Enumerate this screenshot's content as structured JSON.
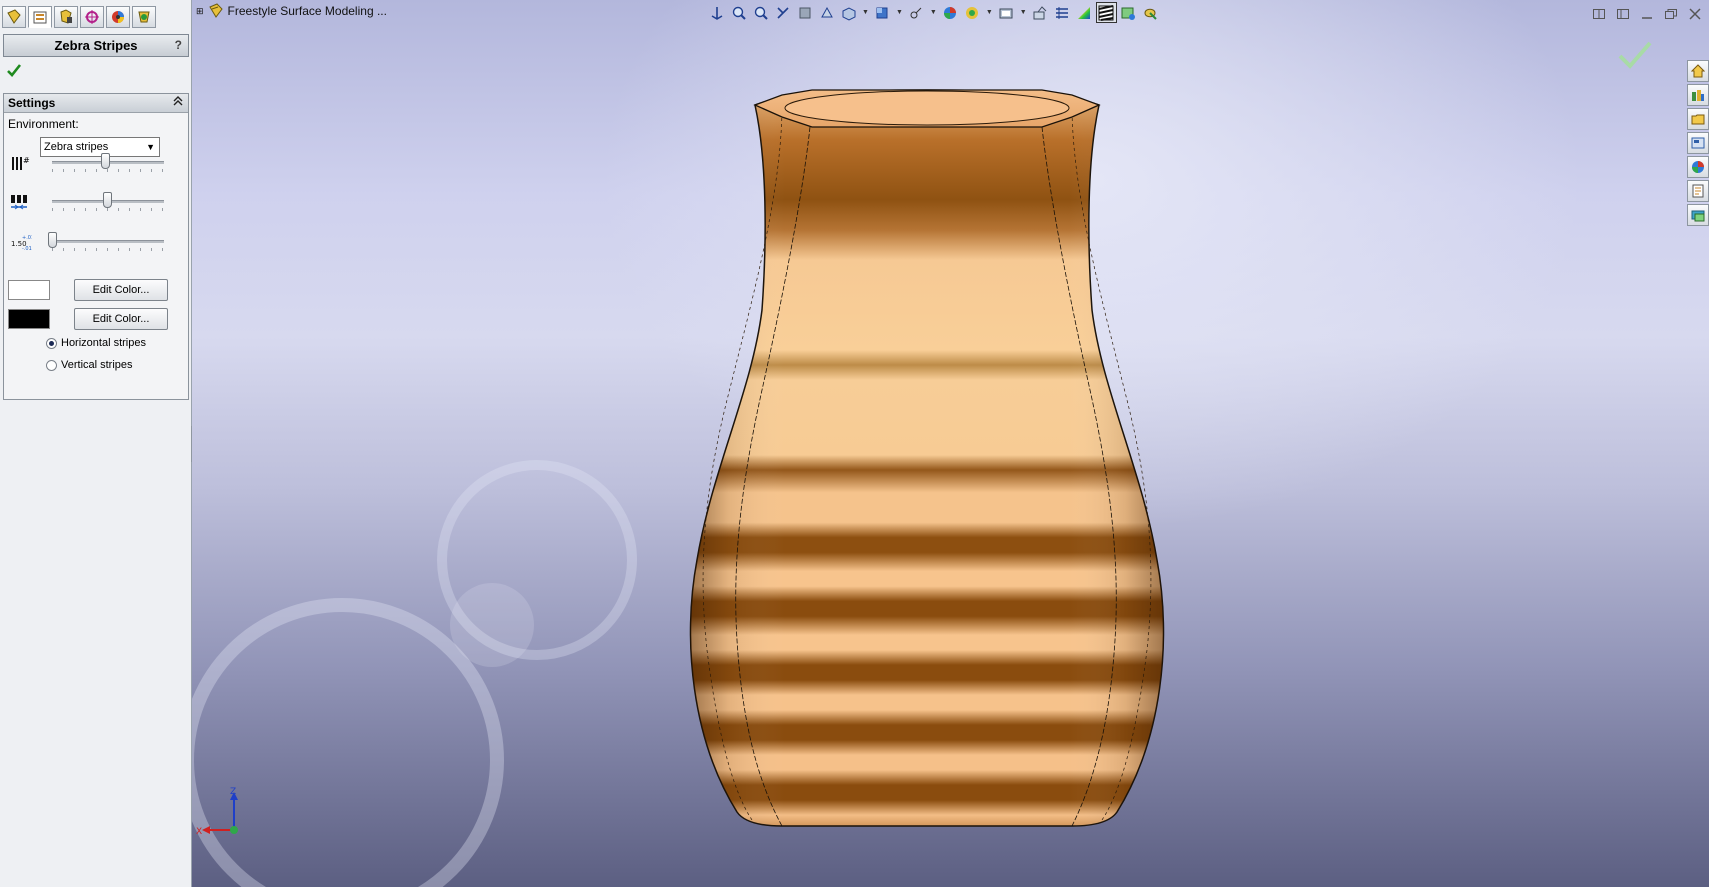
{
  "document": {
    "title": "Freestyle Surface Modeling ..."
  },
  "property_manager": {
    "tabs": [
      "feature-manager",
      "property-manager",
      "configuration-manager",
      "dimxpert-manager",
      "display-manager",
      "cam-manager"
    ],
    "title": "Zebra Stripes",
    "help": "?",
    "settings": {
      "header": "Settings",
      "environment_label": "Environment:",
      "environment_value": "Zebra stripes",
      "sliders": [
        {
          "name": "number-of-stripes",
          "value": 0.47
        },
        {
          "name": "stripe-width",
          "value": 0.49
        },
        {
          "name": "precision",
          "value": 0.0
        }
      ],
      "colors": [
        {
          "swatch": "#ffffff",
          "button": "Edit Color..."
        },
        {
          "swatch": "#000000",
          "button": "Edit Color..."
        }
      ],
      "radio_options": [
        {
          "label": "Horizontal stripes",
          "selected": true
        },
        {
          "label": "Vertical stripes",
          "selected": false
        }
      ]
    }
  },
  "view_toolbar": {
    "icons": [
      "zoom-to-fit-icon",
      "zoom-to-area-icon",
      "previous-view-icon",
      "section-view-icon",
      "dynamic-annotation-icon",
      "view-orientation-icon",
      "display-style-icon",
      "hide-show-items-icon",
      "edit-appearance-icon",
      "apply-scene-icon",
      "view-settings-icon",
      "rotate-view-icon",
      "pan-icon",
      "curvature-icon",
      "zebra-stripes-icon",
      "render-tools-icon",
      "ambient-occlusion-icon"
    ],
    "active_icon": "zebra-stripes-icon"
  },
  "task_pane": {
    "icons": [
      "solidworks-resources-icon",
      "design-library-icon",
      "file-explorer-icon",
      "view-palette-icon",
      "appearances-icon",
      "custom-properties-icon",
      "forum-icon"
    ]
  },
  "triad": {
    "x": "X",
    "y": "Y",
    "z": "Z"
  },
  "colors": {
    "vase_light": "#f6c691",
    "vase_dark": "#8a4d0e",
    "accent_ok": "#2e9b2e"
  }
}
